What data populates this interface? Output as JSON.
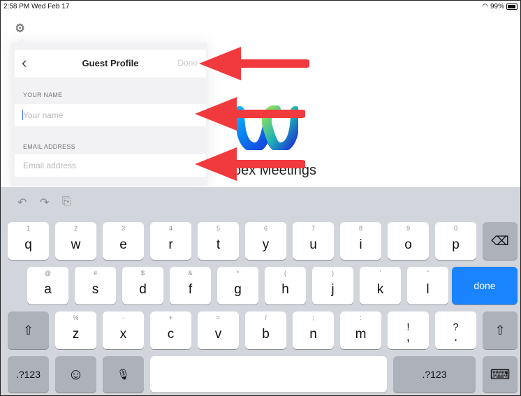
{
  "status_bar": {
    "time_date": "2:58 PM  Wed Feb 17",
    "battery": "99%"
  },
  "settings": {
    "icon": "gear-icon"
  },
  "background": {
    "app_title": "bex Meetings"
  },
  "guest_profile": {
    "back": "‹",
    "title": "Guest Profile",
    "done": "Done",
    "name_section": "YOUR NAME",
    "name_placeholder": "Your name",
    "email_section": "EMAIL ADDRESS",
    "email_placeholder": "Email address"
  },
  "annotations": {
    "arrow_color": "#f03a3e",
    "count": 3
  },
  "keyboard": {
    "toolbar": {
      "undo": "↶",
      "redo": "↷",
      "paste": "⎘"
    },
    "row1": [
      {
        "hint": "1",
        "key": "q"
      },
      {
        "hint": "2",
        "key": "w"
      },
      {
        "hint": "3",
        "key": "e"
      },
      {
        "hint": "4",
        "key": "r"
      },
      {
        "hint": "5",
        "key": "t"
      },
      {
        "hint": "6",
        "key": "y"
      },
      {
        "hint": "7",
        "key": "u"
      },
      {
        "hint": "8",
        "key": "i"
      },
      {
        "hint": "9",
        "key": "o"
      },
      {
        "hint": "0",
        "key": "p"
      }
    ],
    "backspace": "⌫",
    "row2": [
      {
        "hint": "@",
        "key": "a"
      },
      {
        "hint": "#",
        "key": "s"
      },
      {
        "hint": "$",
        "key": "d"
      },
      {
        "hint": "&",
        "key": "f"
      },
      {
        "hint": "*",
        "key": "g"
      },
      {
        "hint": "(",
        "key": "h"
      },
      {
        "hint": ")",
        "key": "j"
      },
      {
        "hint": "’",
        "key": "k"
      },
      {
        "hint": "”",
        "key": "l"
      }
    ],
    "done": "done",
    "shift": "⇧",
    "row3": [
      {
        "hint": "%",
        "key": "z"
      },
      {
        "hint": "-",
        "key": "x"
      },
      {
        "hint": "+",
        "key": "c"
      },
      {
        "hint": "=",
        "key": "v"
      },
      {
        "hint": "/",
        "key": "b"
      },
      {
        "hint": ";",
        "key": "n"
      },
      {
        "hint": ":",
        "key": "m"
      },
      {
        "hint": "!",
        "key": ","
      },
      {
        "hint": "?",
        "key": "."
      }
    ],
    "numbers": ".?123",
    "emoji": "☺",
    "mic": "🎙",
    "hide": "⌨"
  }
}
